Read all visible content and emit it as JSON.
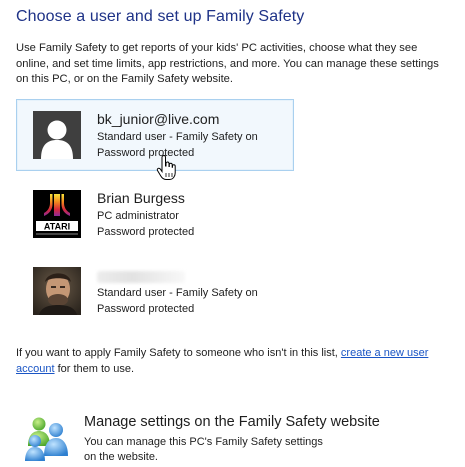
{
  "heading": "Choose a user and set up Family Safety",
  "intro": "Use Family Safety to get reports of your kids' PC activities, choose what they see online, and set time limits, app restrictions, and more. You can manage these settings on this PC, or on the Family Safety website.",
  "users": [
    {
      "name": "bk_junior@live.com",
      "type": "Standard user - Family Safety on",
      "status": "Password protected",
      "avatar_icon": "default-user-silhouette-icon",
      "selected": true
    },
    {
      "name": "Brian Burgess",
      "type": "PC administrator",
      "status": "Password protected",
      "avatar_icon": "atari-logo-picture",
      "avatar_text": "ATARI"
    },
    {
      "name": "",
      "type": "Standard user - Family Safety on",
      "status": "Password protected",
      "avatar_icon": "photo-of-person"
    }
  ],
  "note": {
    "before": "If you want to apply Family Safety to someone who isn't in this list, ",
    "link": "create a new user account",
    "after": " for them to use."
  },
  "manage": {
    "title": "Manage settings on the Family Safety website",
    "desc": "You can manage this PC's Family Safety settings on the website.",
    "icon": "family-users-icon"
  },
  "colors": {
    "heading": "#1e3287",
    "link": "#1a55c5",
    "selected_bg": "#f2f8fd",
    "selected_border": "#a9d0ef"
  }
}
